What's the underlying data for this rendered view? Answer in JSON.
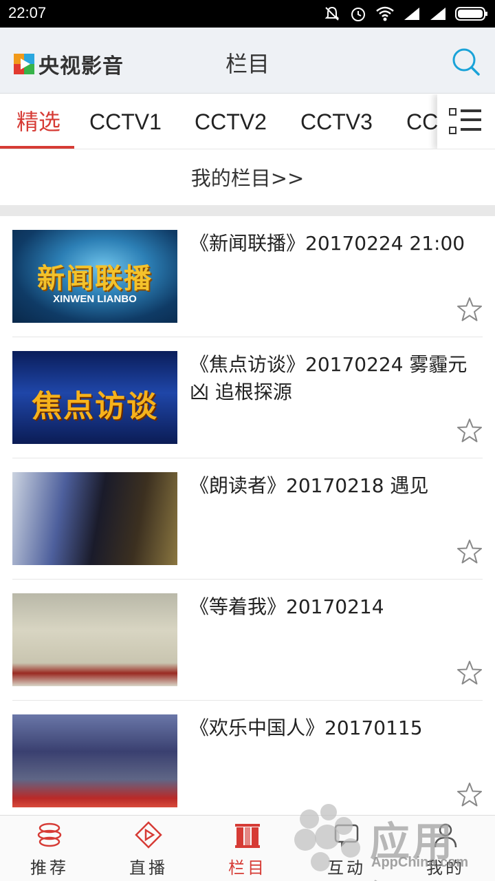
{
  "status_bar": {
    "time": "22:07",
    "icons": [
      "mute-icon",
      "alarm-icon",
      "wifi-icon",
      "signal-icon",
      "signal-icon",
      "battery-icon"
    ]
  },
  "header": {
    "app_name": "央视影音",
    "title": "栏目",
    "search_icon": "search-icon"
  },
  "tabs": {
    "items": [
      "精选",
      "CCTV1",
      "CCTV2",
      "CCTV3",
      "CC"
    ],
    "active_index": 0,
    "more_icon": "list-menu-icon"
  },
  "my_columns_label": "我的栏目>>",
  "thumbnails": {
    "t1_big": "新闻联播",
    "t1_small": "XINWEN LIANBO",
    "t2_big": "焦点访谈"
  },
  "list": [
    {
      "title": "《新闻联播》20170224 21:00"
    },
    {
      "title": "《焦点访谈》20170224 雾霾元凶 追根探源"
    },
    {
      "title": "《朗读者》20170218 遇见"
    },
    {
      "title": "《等着我》20170214"
    },
    {
      "title": "《欢乐中国人》20170115"
    }
  ],
  "bottom_nav": {
    "items": [
      {
        "label": "推荐",
        "icon": "recommend-icon"
      },
      {
        "label": "直播",
        "icon": "play-icon"
      },
      {
        "label": "栏目",
        "icon": "columns-icon"
      },
      {
        "label": "互动",
        "icon": "chat-icon"
      },
      {
        "label": "我的",
        "icon": "user-icon"
      }
    ],
    "active_index": 2
  },
  "watermark": {
    "text": "应用汇",
    "sub": "AppChina.com"
  },
  "colors": {
    "accent": "#d63b35",
    "header_bg": "#eef1f5",
    "search": "#1aa3d8"
  }
}
